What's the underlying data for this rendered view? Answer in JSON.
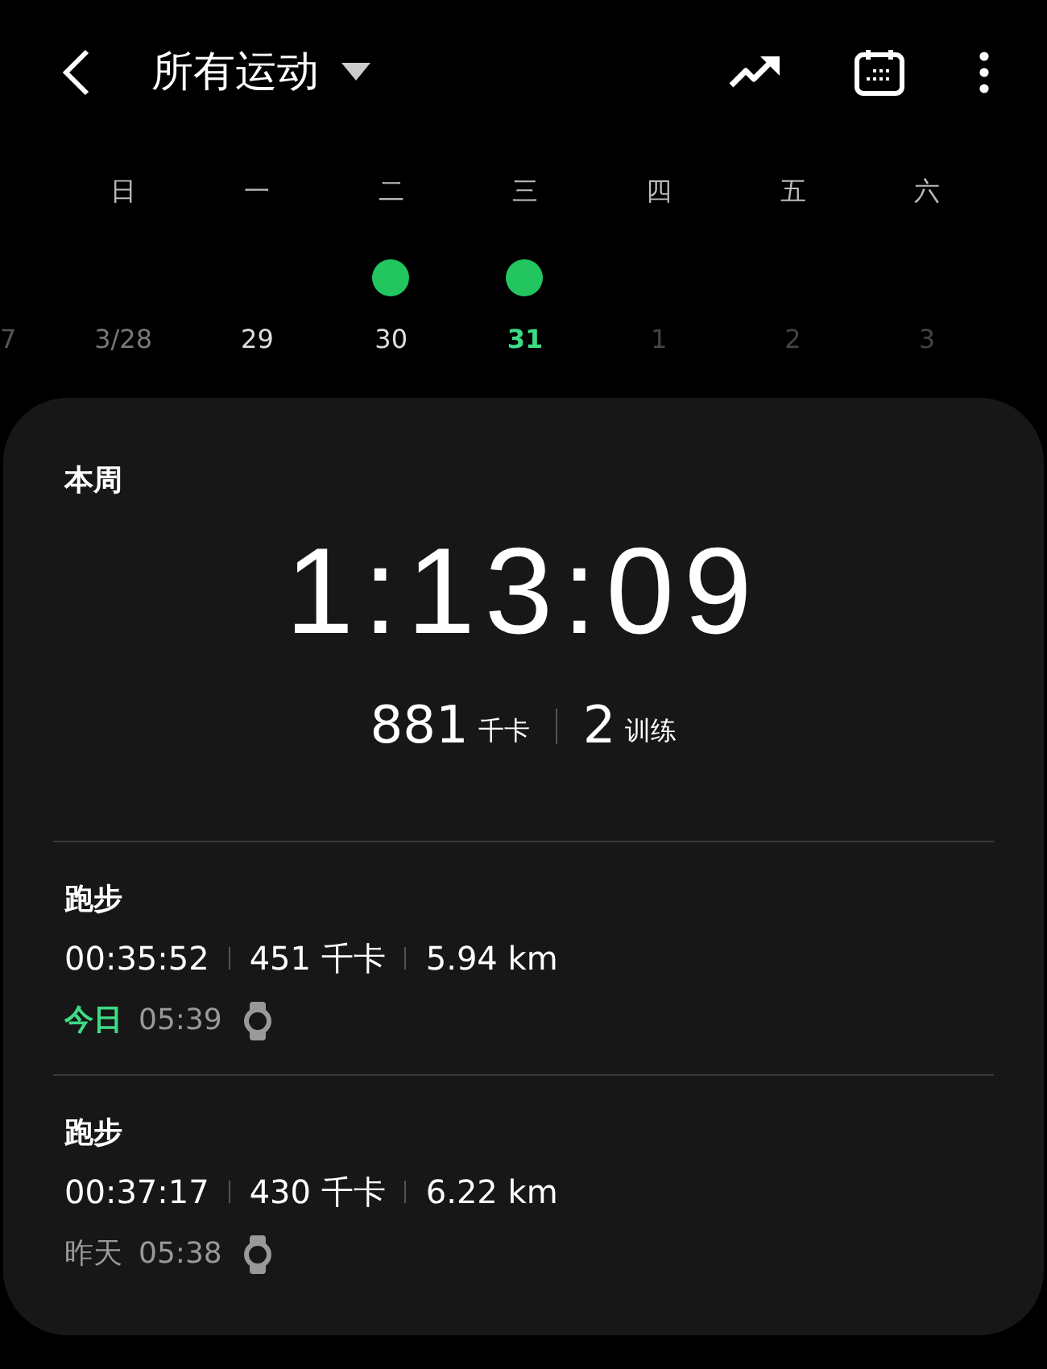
{
  "header": {
    "title": "所有运动"
  },
  "calendar": {
    "previous_cut": "7",
    "days": [
      {
        "weekday": "日",
        "date": "3/28",
        "kind": "dim",
        "has_workout": false
      },
      {
        "weekday": "一",
        "date": "29",
        "kind": "normal",
        "has_workout": false
      },
      {
        "weekday": "二",
        "date": "30",
        "kind": "normal",
        "has_workout": true
      },
      {
        "weekday": "三",
        "date": "31",
        "kind": "today",
        "has_workout": true
      },
      {
        "weekday": "四",
        "date": "1",
        "kind": "future",
        "has_workout": false
      },
      {
        "weekday": "五",
        "date": "2",
        "kind": "future",
        "has_workout": false
      },
      {
        "weekday": "六",
        "date": "3",
        "kind": "future",
        "has_workout": false
      }
    ]
  },
  "summary": {
    "label": "本周",
    "total_time": "1:13:09",
    "calories": "881",
    "calories_unit": "千卡",
    "workouts": "2",
    "workouts_unit": "训练"
  },
  "activities": [
    {
      "name": "跑步",
      "duration": "00:35:52",
      "calories": "451 千卡",
      "distance": "5.94 km",
      "day": "今日",
      "today": true,
      "time": "05:39"
    },
    {
      "name": "跑步",
      "duration": "00:37:17",
      "calories": "430 千卡",
      "distance": "6.22 km",
      "day": "昨天",
      "today": false,
      "time": "05:38"
    }
  ]
}
